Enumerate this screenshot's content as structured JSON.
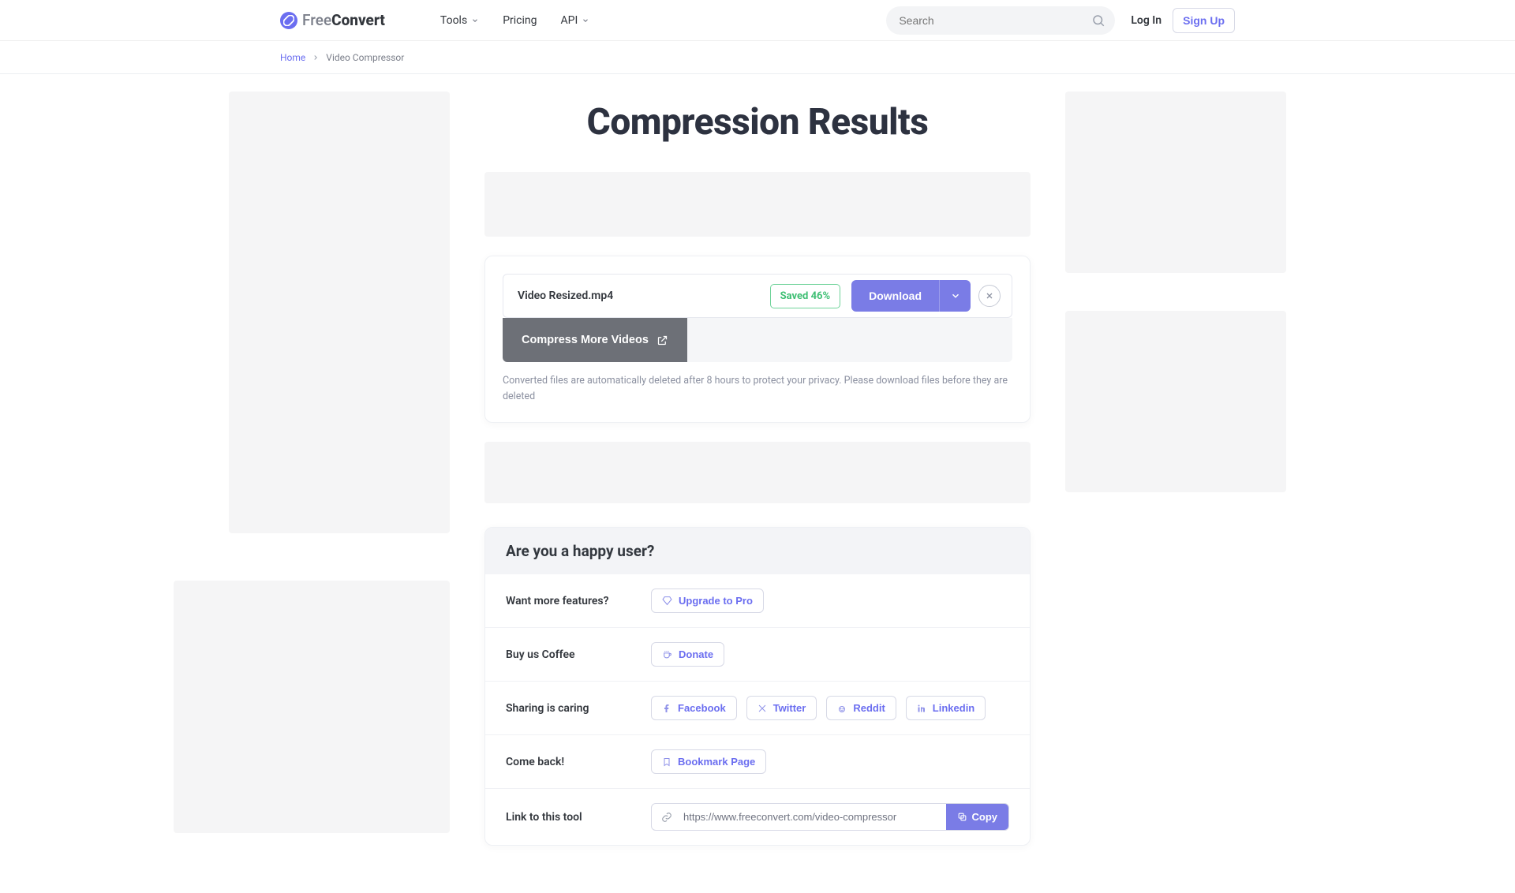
{
  "header": {
    "logo_free": "Free",
    "logo_convert": "Convert",
    "nav": {
      "tools": "Tools",
      "pricing": "Pricing",
      "api": "API"
    },
    "search_placeholder": "Search",
    "login": "Log In",
    "signup": "Sign Up"
  },
  "breadcrumb": {
    "home": "Home",
    "current": "Video Compressor"
  },
  "page": {
    "title": "Compression Results"
  },
  "result": {
    "file_name": "Video Resized.mp4",
    "saved_badge": "Saved 46%",
    "download": "Download",
    "compress_more": "Compress More Videos",
    "privacy_note": "Converted files are automatically deleted after 8 hours to protect your privacy. Please download files before they are deleted"
  },
  "happy": {
    "header": "Are you a happy user?",
    "rows": {
      "features": {
        "label": "Want more features?",
        "cta": "Upgrade to Pro"
      },
      "coffee": {
        "label": "Buy us Coffee",
        "cta": "Donate"
      },
      "sharing": {
        "label": "Sharing is caring",
        "facebook": "Facebook",
        "twitter": "Twitter",
        "reddit": "Reddit",
        "linkedin": "Linkedin"
      },
      "comeback": {
        "label": "Come back!",
        "cta": "Bookmark Page"
      },
      "link": {
        "label": "Link to this tool",
        "url": "https://www.freeconvert.com/video-compressor",
        "copy": "Copy"
      }
    }
  },
  "colors": {
    "accent": "#7a7ce6",
    "success": "#3fbf74"
  }
}
